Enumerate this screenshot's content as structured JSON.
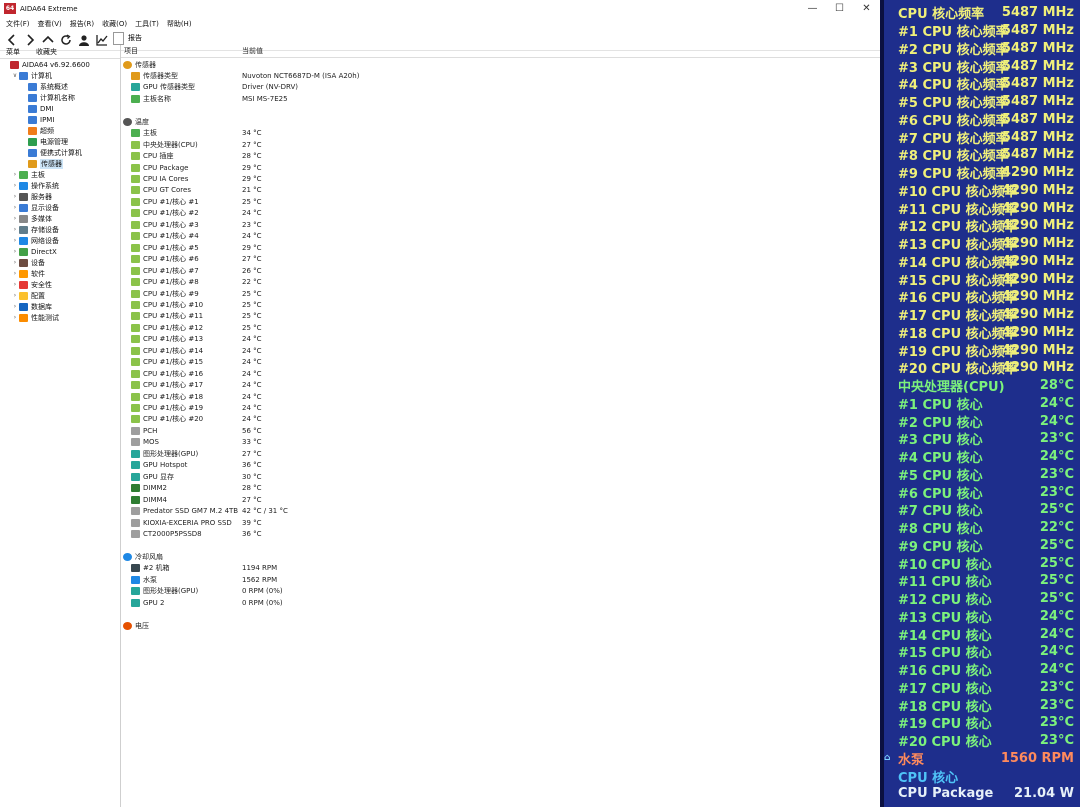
{
  "colors": {
    "osd_bg": "#1e2e8c",
    "freq_text": "#f0f07a",
    "temp_text": "#7cf27c",
    "pump_text": "#ff8a5c",
    "pkg_text": "#e6f0f8",
    "cpu_core_text": "#4fc3f7"
  },
  "app": {
    "title": "AIDA64 Extreme",
    "logo": "64",
    "menu": [
      "文件(F)",
      "查看(V)",
      "报告(R)",
      "收藏(O)",
      "工具(T)",
      "帮助(H)"
    ],
    "report_tab": "报告",
    "left_tabs": [
      "菜单",
      "收藏夹"
    ],
    "tree": [
      {
        "label": "AIDA64 v6.92.6600",
        "icon": "aida-icon",
        "depth": 0,
        "arrow": ""
      },
      {
        "label": "计算机",
        "icon": "computer-icon",
        "depth": 1,
        "arrow": "v"
      },
      {
        "label": "系统概述",
        "icon": "computer-icon",
        "depth": 2,
        "arrow": ""
      },
      {
        "label": "计算机名称",
        "icon": "computer-icon",
        "depth": 2,
        "arrow": ""
      },
      {
        "label": "DMI",
        "icon": "computer-icon",
        "depth": 2,
        "arrow": ""
      },
      {
        "label": "IPMI",
        "icon": "computer-icon",
        "depth": 2,
        "arrow": ""
      },
      {
        "label": "超频",
        "icon": "fire-icon",
        "depth": 2,
        "arrow": ""
      },
      {
        "label": "电源管理",
        "icon": "power-icon",
        "depth": 2,
        "arrow": ""
      },
      {
        "label": "便携式计算机",
        "icon": "laptop-icon",
        "depth": 2,
        "arrow": ""
      },
      {
        "label": "传感器",
        "icon": "sensor-icon",
        "depth": 2,
        "arrow": "",
        "selected": true
      },
      {
        "label": "主板",
        "icon": "motherboard-icon",
        "depth": 1,
        "arrow": ">"
      },
      {
        "label": "操作系统",
        "icon": "windows-icon",
        "depth": 1,
        "arrow": ">"
      },
      {
        "label": "服务器",
        "icon": "server-icon",
        "depth": 1,
        "arrow": ">"
      },
      {
        "label": "显示设备",
        "icon": "display-icon",
        "depth": 1,
        "arrow": ">"
      },
      {
        "label": "多媒体",
        "icon": "speaker-icon",
        "depth": 1,
        "arrow": ">"
      },
      {
        "label": "存储设备",
        "icon": "storage-icon",
        "depth": 1,
        "arrow": ">"
      },
      {
        "label": "网络设备",
        "icon": "network-icon",
        "depth": 1,
        "arrow": ">"
      },
      {
        "label": "DirectX",
        "icon": "directx-icon",
        "depth": 1,
        "arrow": ">"
      },
      {
        "label": "设备",
        "icon": "device-icon",
        "depth": 1,
        "arrow": ">"
      },
      {
        "label": "软件",
        "icon": "software-icon",
        "depth": 1,
        "arrow": ">"
      },
      {
        "label": "安全性",
        "icon": "shield-icon",
        "depth": 1,
        "arrow": ">"
      },
      {
        "label": "配置",
        "icon": "config-icon",
        "depth": 1,
        "arrow": ">"
      },
      {
        "label": "数据库",
        "icon": "database-icon",
        "depth": 1,
        "arrow": ">"
      },
      {
        "label": "性能测试",
        "icon": "benchmark-icon",
        "depth": 1,
        "arrow": ">"
      }
    ],
    "columns": [
      "项目",
      "当前值"
    ],
    "sections": [
      {
        "title": "传感器",
        "icon": "sensor-icon",
        "rows": [
          {
            "label": "传感器类型",
            "value": "Nuvoton NCT6687D-M  (ISA A20h)",
            "icon": "sensor-icon"
          },
          {
            "label": "GPU 传感器类型",
            "value": "Driver  (NV-DRV)",
            "icon": "gpu-icon"
          },
          {
            "label": "主板名称",
            "value": "MSI MS-7E25",
            "icon": "motherboard-icon"
          }
        ]
      },
      {
        "title": "温度",
        "icon": "thermometer-icon",
        "rows": [
          {
            "label": "主板",
            "value": "34 °C",
            "icon": "motherboard-icon"
          },
          {
            "label": "中央处理器(CPU)",
            "value": "27 °C",
            "icon": "cpu-icon"
          },
          {
            "label": "CPU 插座",
            "value": "28 °C",
            "icon": "cpu-icon"
          },
          {
            "label": "CPU Package",
            "value": "29 °C",
            "icon": "cpu-icon"
          },
          {
            "label": "CPU IA Cores",
            "value": "29 °C",
            "icon": "cpu-icon"
          },
          {
            "label": "CPU GT Cores",
            "value": "21 °C",
            "icon": "cpu-icon"
          },
          {
            "label": "CPU #1/核心 #1",
            "value": "25 °C",
            "icon": "cpu-icon"
          },
          {
            "label": "CPU #1/核心 #2",
            "value": "24 °C",
            "icon": "cpu-icon"
          },
          {
            "label": "CPU #1/核心 #3",
            "value": "23 °C",
            "icon": "cpu-icon"
          },
          {
            "label": "CPU #1/核心 #4",
            "value": "24 °C",
            "icon": "cpu-icon"
          },
          {
            "label": "CPU #1/核心 #5",
            "value": "29 °C",
            "icon": "cpu-icon"
          },
          {
            "label": "CPU #1/核心 #6",
            "value": "27 °C",
            "icon": "cpu-icon"
          },
          {
            "label": "CPU #1/核心 #7",
            "value": "26 °C",
            "icon": "cpu-icon"
          },
          {
            "label": "CPU #1/核心 #8",
            "value": "22 °C",
            "icon": "cpu-icon"
          },
          {
            "label": "CPU #1/核心 #9",
            "value": "25 °C",
            "icon": "cpu-icon"
          },
          {
            "label": "CPU #1/核心 #10",
            "value": "25 °C",
            "icon": "cpu-icon"
          },
          {
            "label": "CPU #1/核心 #11",
            "value": "25 °C",
            "icon": "cpu-icon"
          },
          {
            "label": "CPU #1/核心 #12",
            "value": "25 °C",
            "icon": "cpu-icon"
          },
          {
            "label": "CPU #1/核心 #13",
            "value": "24 °C",
            "icon": "cpu-icon"
          },
          {
            "label": "CPU #1/核心 #14",
            "value": "24 °C",
            "icon": "cpu-icon"
          },
          {
            "label": "CPU #1/核心 #15",
            "value": "24 °C",
            "icon": "cpu-icon"
          },
          {
            "label": "CPU #1/核心 #16",
            "value": "24 °C",
            "icon": "cpu-icon"
          },
          {
            "label": "CPU #1/核心 #17",
            "value": "24 °C",
            "icon": "cpu-icon"
          },
          {
            "label": "CPU #1/核心 #18",
            "value": "24 °C",
            "icon": "cpu-icon"
          },
          {
            "label": "CPU #1/核心 #19",
            "value": "24 °C",
            "icon": "cpu-icon"
          },
          {
            "label": "CPU #1/核心 #20",
            "value": "24 °C",
            "icon": "cpu-icon"
          },
          {
            "label": "PCH",
            "value": "56 °C",
            "icon": "chip-icon"
          },
          {
            "label": "MOS",
            "value": "33 °C",
            "icon": "chip-icon"
          },
          {
            "label": "图形处理器(GPU)",
            "value": "27 °C",
            "icon": "gpu-icon"
          },
          {
            "label": "GPU Hotspot",
            "value": "36 °C",
            "icon": "gpu-icon"
          },
          {
            "label": "GPU 显存",
            "value": "30 °C",
            "icon": "gpu-icon"
          },
          {
            "label": "DIMM2",
            "value": "28 °C",
            "icon": "memory-icon"
          },
          {
            "label": "DIMM4",
            "value": "27 °C",
            "icon": "memory-icon"
          },
          {
            "label": "Predator SSD GM7 M.2 4TB",
            "value": "42 °C / 31 °C",
            "icon": "disk-icon"
          },
          {
            "label": "KIOXIA-EXCERIA PRO SSD",
            "value": "39 °C",
            "icon": "disk-icon"
          },
          {
            "label": "CT2000P5PSSD8",
            "value": "36 °C",
            "icon": "disk-icon"
          }
        ]
      },
      {
        "title": "冷却风扇",
        "icon": "fan-icon",
        "rows": [
          {
            "label": "#2 机箱",
            "value": "1194 RPM",
            "icon": "case-icon"
          },
          {
            "label": "水泵",
            "value": "1562 RPM",
            "icon": "fan-icon"
          },
          {
            "label": "图形处理器(GPU)",
            "value": "0 RPM  (0%)",
            "icon": "gpu-icon"
          },
          {
            "label": "GPU 2",
            "value": "0 RPM  (0%)",
            "icon": "gpu-icon"
          }
        ]
      },
      {
        "title": "电压",
        "icon": "voltage-icon",
        "rows": []
      }
    ]
  },
  "osd": {
    "rows": [
      {
        "label": "CPU 核心频率",
        "value": "5487 MHz",
        "kind": "freq"
      },
      {
        "label": "#1 CPU 核心频率",
        "value": "5487 MHz",
        "kind": "freq"
      },
      {
        "label": "#2 CPU 核心频率",
        "value": "5487 MHz",
        "kind": "freq"
      },
      {
        "label": "#3 CPU 核心频率",
        "value": "5487 MHz",
        "kind": "freq"
      },
      {
        "label": "#4 CPU 核心频率",
        "value": "5487 MHz",
        "kind": "freq"
      },
      {
        "label": "#5 CPU 核心频率",
        "value": "5487 MHz",
        "kind": "freq"
      },
      {
        "label": "#6 CPU 核心频率",
        "value": "5487 MHz",
        "kind": "freq"
      },
      {
        "label": "#7 CPU 核心频率",
        "value": "5487 MHz",
        "kind": "freq"
      },
      {
        "label": "#8 CPU 核心频率",
        "value": "5487 MHz",
        "kind": "freq"
      },
      {
        "label": "#9 CPU 核心频率",
        "value": "4290 MHz",
        "kind": "freq"
      },
      {
        "label": "#10 CPU 核心频率",
        "value": "4290 MHz",
        "kind": "freq"
      },
      {
        "label": "#11 CPU 核心频率",
        "value": "4290 MHz",
        "kind": "freq"
      },
      {
        "label": "#12 CPU 核心频率",
        "value": "4290 MHz",
        "kind": "freq"
      },
      {
        "label": "#13 CPU 核心频率",
        "value": "4290 MHz",
        "kind": "freq"
      },
      {
        "label": "#14 CPU 核心频率",
        "value": "4290 MHz",
        "kind": "freq"
      },
      {
        "label": "#15 CPU 核心频率",
        "value": "4290 MHz",
        "kind": "freq"
      },
      {
        "label": "#16 CPU 核心频率",
        "value": "4290 MHz",
        "kind": "freq"
      },
      {
        "label": "#17 CPU 核心频率",
        "value": "4290 MHz",
        "kind": "freq"
      },
      {
        "label": "#18 CPU 核心频率",
        "value": "4290 MHz",
        "kind": "freq"
      },
      {
        "label": "#19 CPU 核心频率",
        "value": "4290 MHz",
        "kind": "freq"
      },
      {
        "label": "#20 CPU 核心频率",
        "value": "4290 MHz",
        "kind": "freq"
      },
      {
        "label": "中央处理器(CPU)",
        "value": "28°C",
        "kind": "temp"
      },
      {
        "label": "#1 CPU 核心",
        "value": "24°C",
        "kind": "temp"
      },
      {
        "label": "#2 CPU 核心",
        "value": "24°C",
        "kind": "temp"
      },
      {
        "label": "#3 CPU 核心",
        "value": "23°C",
        "kind": "temp"
      },
      {
        "label": "#4 CPU 核心",
        "value": "24°C",
        "kind": "temp"
      },
      {
        "label": "#5 CPU 核心",
        "value": "23°C",
        "kind": "temp"
      },
      {
        "label": "#6 CPU 核心",
        "value": "23°C",
        "kind": "temp"
      },
      {
        "label": "#7 CPU 核心",
        "value": "25°C",
        "kind": "temp"
      },
      {
        "label": "#8 CPU 核心",
        "value": "22°C",
        "kind": "temp"
      },
      {
        "label": "#9 CPU 核心",
        "value": "25°C",
        "kind": "temp"
      },
      {
        "label": "#10 CPU 核心",
        "value": "25°C",
        "kind": "temp"
      },
      {
        "label": "#11 CPU 核心",
        "value": "25°C",
        "kind": "temp"
      },
      {
        "label": "#12 CPU 核心",
        "value": "25°C",
        "kind": "temp"
      },
      {
        "label": "#13 CPU 核心",
        "value": "24°C",
        "kind": "temp"
      },
      {
        "label": "#14 CPU 核心",
        "value": "24°C",
        "kind": "temp"
      },
      {
        "label": "#15 CPU 核心",
        "value": "24°C",
        "kind": "temp"
      },
      {
        "label": "#16 CPU 核心",
        "value": "24°C",
        "kind": "temp"
      },
      {
        "label": "#17 CPU 核心",
        "value": "23°C",
        "kind": "temp"
      },
      {
        "label": "#18 CPU 核心",
        "value": "23°C",
        "kind": "temp"
      },
      {
        "label": "#19 CPU 核心",
        "value": "23°C",
        "kind": "temp"
      },
      {
        "label": "#20 CPU 核心",
        "value": "23°C",
        "kind": "temp"
      },
      {
        "label": "水泵",
        "value": "1560 RPM",
        "kind": "pump"
      },
      {
        "label": "CPU 核心",
        "value": "",
        "kind": "cpucore"
      },
      {
        "label": "CPU Package",
        "value": "21.04 W",
        "kind": "pkg"
      }
    ]
  }
}
